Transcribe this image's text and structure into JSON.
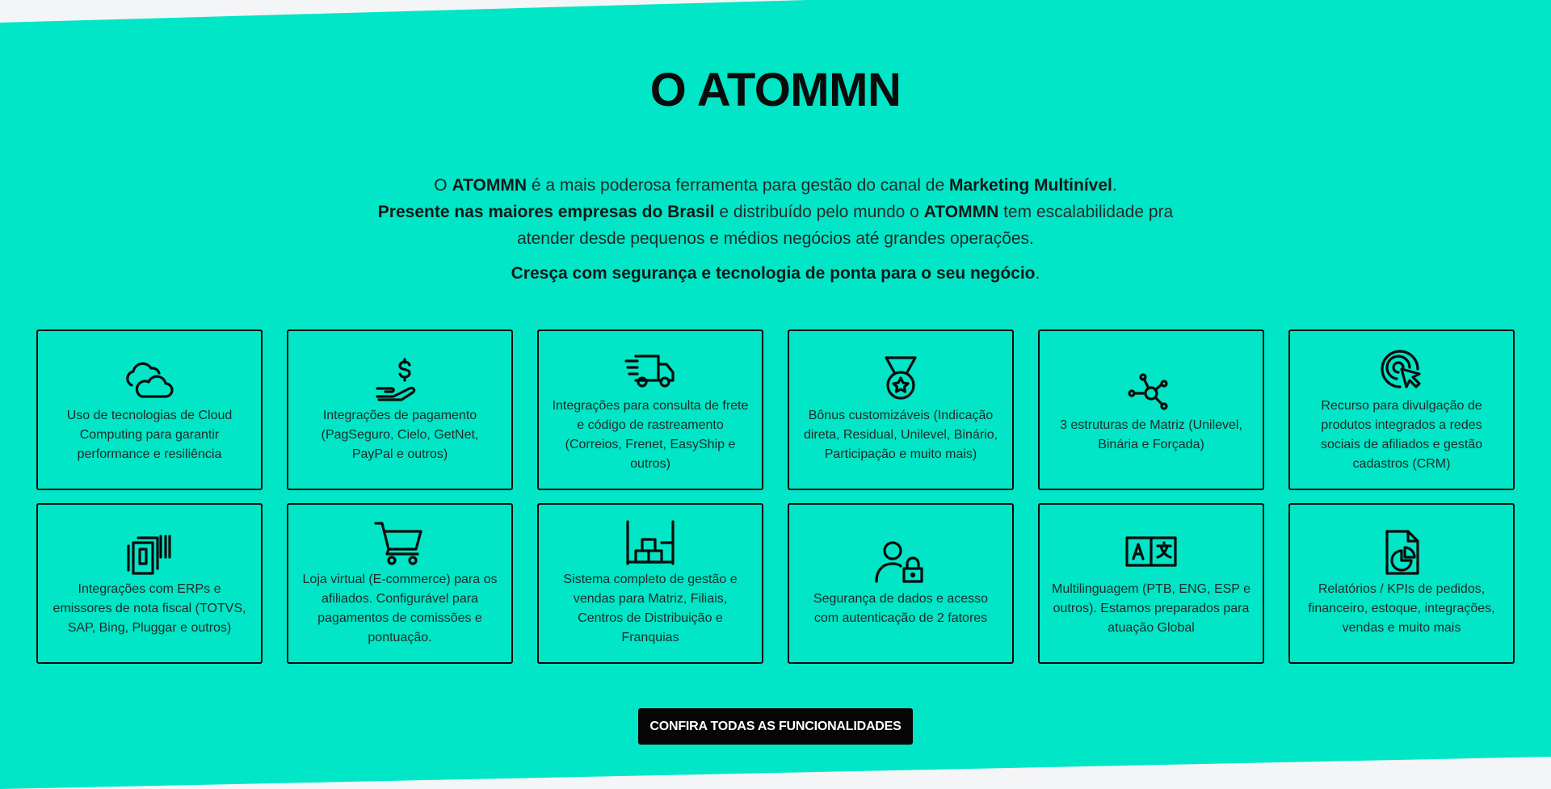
{
  "section": {
    "title": "O ATOMMN",
    "intro": {
      "p1_a": "O ",
      "p1_b": "ATOMMN",
      "p1_c": " é a mais poderosa ferramenta para gestão do canal de ",
      "p1_d": "Marketing Multinível",
      "p1_e": ". ",
      "p1_f": "Presente nas maiores empresas do Brasil",
      "p1_g": " e distribuído pelo mundo o ",
      "p1_h": "ATOMMN",
      "p1_i": " tem escalabilidade pra atender desde pequenos e médios negócios até grandes operações."
    },
    "tagline": {
      "bold": "Cresça com segurança e tecnologia de ponta para o seu negócio",
      "end": "."
    },
    "features": [
      {
        "icon": "cloud-icon",
        "label": "Uso de tecnologias de Cloud Computing para garantir performance e resiliência"
      },
      {
        "icon": "payment-hand-icon",
        "label": "Integrações de pagamento (PagSeguro, Cielo, GetNet, PayPal e outros)"
      },
      {
        "icon": "delivery-truck-icon",
        "label": "Integrações para consulta de frete e código de rastreamento (Correios, Frenet, EasyShip e outros)"
      },
      {
        "icon": "medal-icon",
        "label": "Bônus customizáveis (Indicação direta, Residual, Unilevel, Binário, Participação e muito mais)"
      },
      {
        "icon": "network-nodes-icon",
        "label": "3 estruturas de Matriz (Unilevel, Binária e Forçada)"
      },
      {
        "icon": "target-cursor-icon",
        "label": "Recurso para divulgação de produtos integrados a redes sociais de afiliados e gestão cadastros (CRM)"
      },
      {
        "icon": "invoice-barcode-icon",
        "label": "Integrações com ERPs e emissores de nota fiscal (TOTVS, SAP, Bing, Pluggar e outros)"
      },
      {
        "icon": "shopping-cart-icon",
        "label": "Loja virtual (E-commerce) para os afiliados. Configurável para pagamentos de comissões e pontuação."
      },
      {
        "icon": "warehouse-shelves-icon",
        "label": "Sistema completo de gestão e vendas para Matriz, Filiais, Centros de Distribuição e Franquias"
      },
      {
        "icon": "user-lock-icon",
        "label": "Segurança de dados e acesso com autenticação de 2 fatores"
      },
      {
        "icon": "translate-icon",
        "label": "Multilinguagem (PTB, ENG, ESP e outros). Estamos preparados para atuação Global"
      },
      {
        "icon": "report-chart-icon",
        "label": "Relatórios / KPIs de pedidos, financeiro, estoque, integrações, vendas e muito mais"
      }
    ],
    "cta_label": "CONFIRA TODAS AS FUNCIONALIDADES"
  },
  "colors": {
    "band": "#00e6c6",
    "text": "#0b0b0b",
    "button": "#050505",
    "page": "#f4f5f7"
  }
}
